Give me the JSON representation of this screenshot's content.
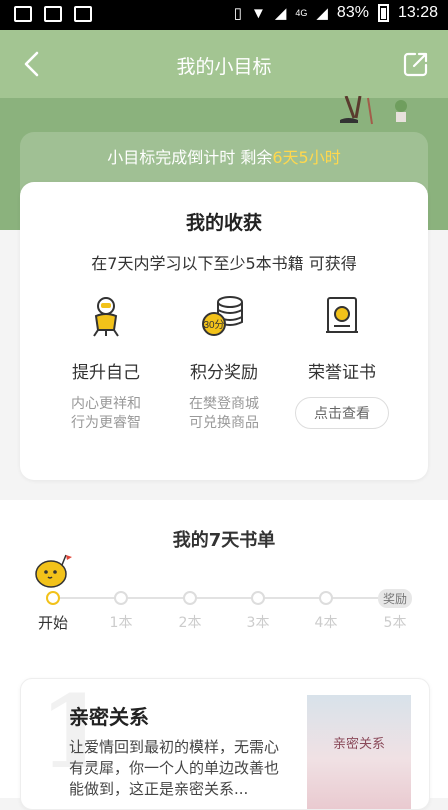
{
  "status_bar": {
    "battery": "83%",
    "time": "13:28",
    "network": "4G"
  },
  "nav": {
    "title": "我的小目标"
  },
  "countdown": {
    "prefix": "小目标完成倒计时 剩余",
    "remaining": "6天5小时"
  },
  "harvest": {
    "title": "我的收获",
    "subtitle": "在7天内学习以下至少5本书籍 可获得",
    "rewards": [
      {
        "icon": "astronaut-icon",
        "title": "提升自己",
        "desc_line1": "内心更祥和",
        "desc_line2": "行为更睿智"
      },
      {
        "icon": "coins-30-icon",
        "title": "积分奖励",
        "desc_line1": "在樊登商城",
        "desc_line2": "可兑换商品"
      },
      {
        "icon": "certificate-icon",
        "title": "荣誉证书",
        "button": "点击查看"
      }
    ]
  },
  "booklist": {
    "title": "我的7天书单",
    "steps": [
      "开始",
      "1本",
      "2本",
      "3本",
      "4本",
      "5本"
    ],
    "reward_badge": "奖励"
  },
  "book": {
    "number": "1",
    "title": "亲密关系",
    "description": "让爱情回到最初的模样，无需心有灵犀，你一个人的单边改善也能做到，这正是亲密关系...",
    "cover_title": "亲密关系"
  },
  "colors": {
    "header_green": "#a3c592",
    "accent_yellow": "#ffd84d"
  }
}
